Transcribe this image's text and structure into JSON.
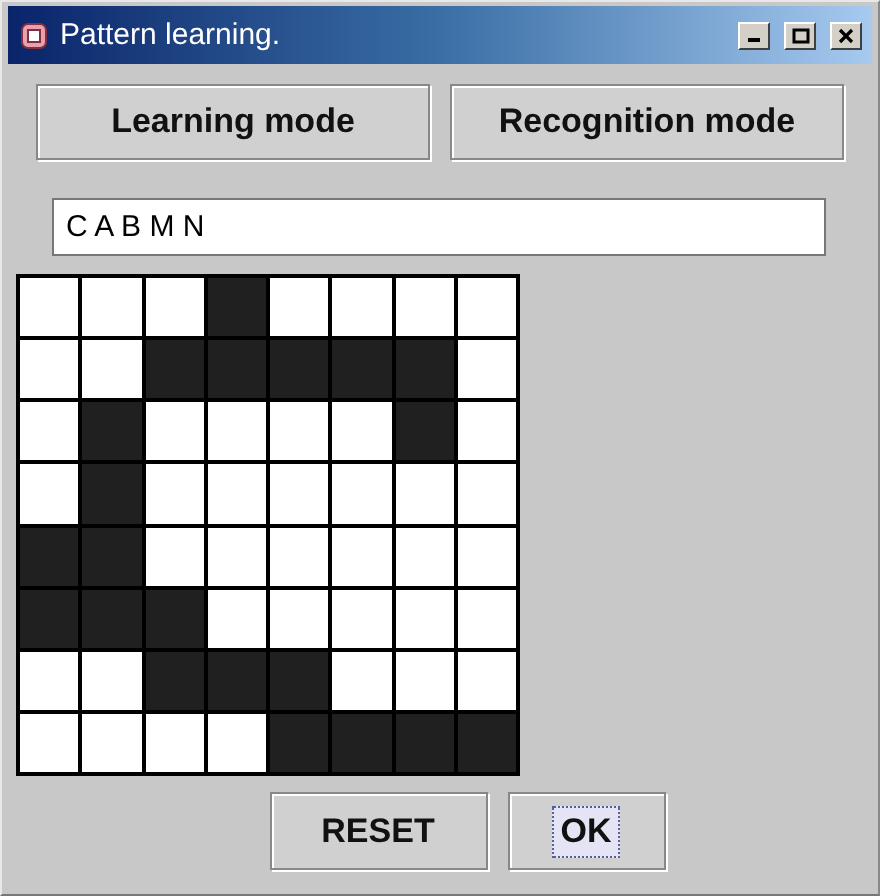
{
  "window": {
    "title": "Pattern learning."
  },
  "mode_buttons": [
    "Learning mode",
    "Recognition mode"
  ],
  "letters_field": {
    "value": "C A B M N"
  },
  "grid": [
    [
      false,
      false,
      false,
      true,
      false,
      false,
      false,
      false
    ],
    [
      false,
      false,
      true,
      true,
      true,
      true,
      true,
      false
    ],
    [
      false,
      true,
      false,
      false,
      false,
      false,
      true,
      false
    ],
    [
      false,
      true,
      false,
      false,
      false,
      false,
      false,
      false
    ],
    [
      true,
      true,
      false,
      false,
      false,
      false,
      false,
      false
    ],
    [
      true,
      true,
      true,
      false,
      false,
      false,
      false,
      false
    ],
    [
      false,
      false,
      true,
      true,
      true,
      false,
      false,
      false
    ],
    [
      false,
      false,
      false,
      false,
      true,
      true,
      true,
      true
    ]
  ],
  "bottom_buttons": [
    {
      "label": "RESET",
      "focused": false
    },
    {
      "label": "OK",
      "focused": true
    }
  ]
}
